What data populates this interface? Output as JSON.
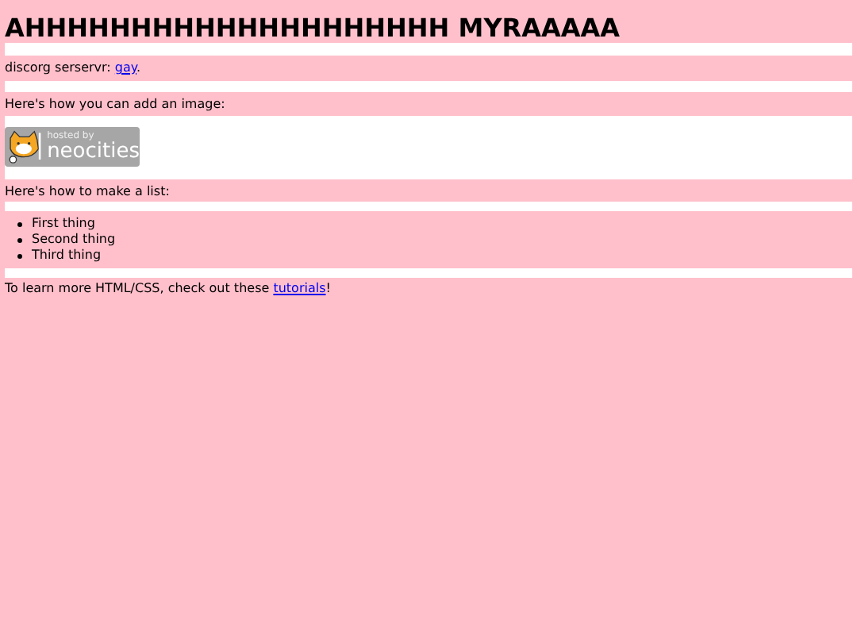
{
  "heading": "AHHHHHHHHHHHHHHHHHHHH MYRAAAAA",
  "discord": {
    "text": "discorg serservr: ",
    "link": "gay",
    "after": "."
  },
  "image_intro": "Here's how you can add an image:",
  "badge": {
    "line_1": "hosted by",
    "line_2": "neocities"
  },
  "list_intro": "Here's how to make a list:",
  "list": [
    "First thing",
    "Second thing",
    "Third thing"
  ],
  "footer": {
    "text": "To learn more HTML/CSS, check out these ",
    "link": "tutorials",
    "after": "!"
  }
}
